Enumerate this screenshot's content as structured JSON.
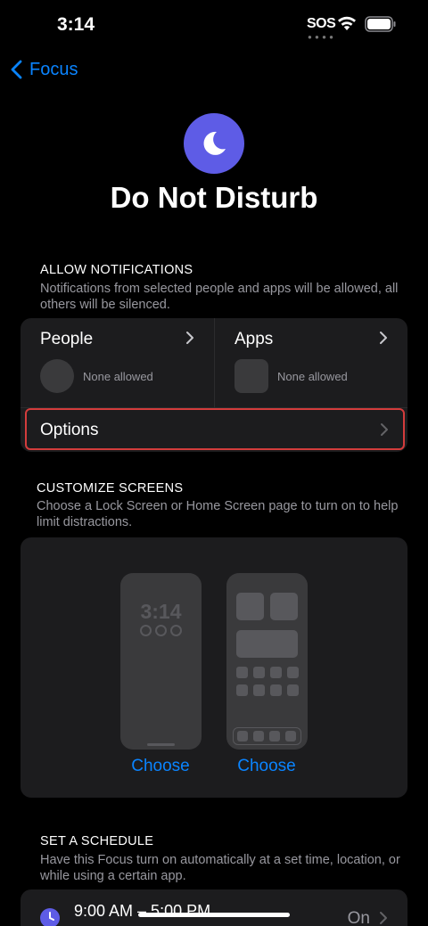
{
  "status_bar": {
    "time": "3:14",
    "carrier": "SOS",
    "icons": [
      "wifi-icon",
      "battery-icon"
    ]
  },
  "nav": {
    "back_label": "Focus",
    "back_icon": "chevron-left-icon"
  },
  "focus": {
    "icon": "moon-icon",
    "title": "Do Not Disturb",
    "accent_color": "#5e5ce6"
  },
  "allow_notifications": {
    "header": "ALLOW NOTIFICATIONS",
    "subtitle": "Notifications from selected people and apps will be allowed, all others will be silenced.",
    "people": {
      "label": "People",
      "status": "None allowed"
    },
    "apps": {
      "label": "Apps",
      "status": "None allowed"
    },
    "options_label": "Options"
  },
  "customize_screens": {
    "header": "CUSTOMIZE SCREENS",
    "subtitle": "Choose a Lock Screen or Home Screen page to turn on to help limit distractions.",
    "lock_preview_time": "3:14",
    "lock_choose": "Choose",
    "home_choose": "Choose"
  },
  "schedule": {
    "header": "SET A SCHEDULE",
    "subtitle": "Have this Focus turn on automatically at a set time, location, or while using a certain app.",
    "item_time": "9:00 AM – 5:00 PM",
    "item_state": "On",
    "item_icon": "clock-icon"
  },
  "colors": {
    "link": "#0a84ff",
    "card": "#1c1c1e",
    "highlight": "#d33c3c"
  }
}
